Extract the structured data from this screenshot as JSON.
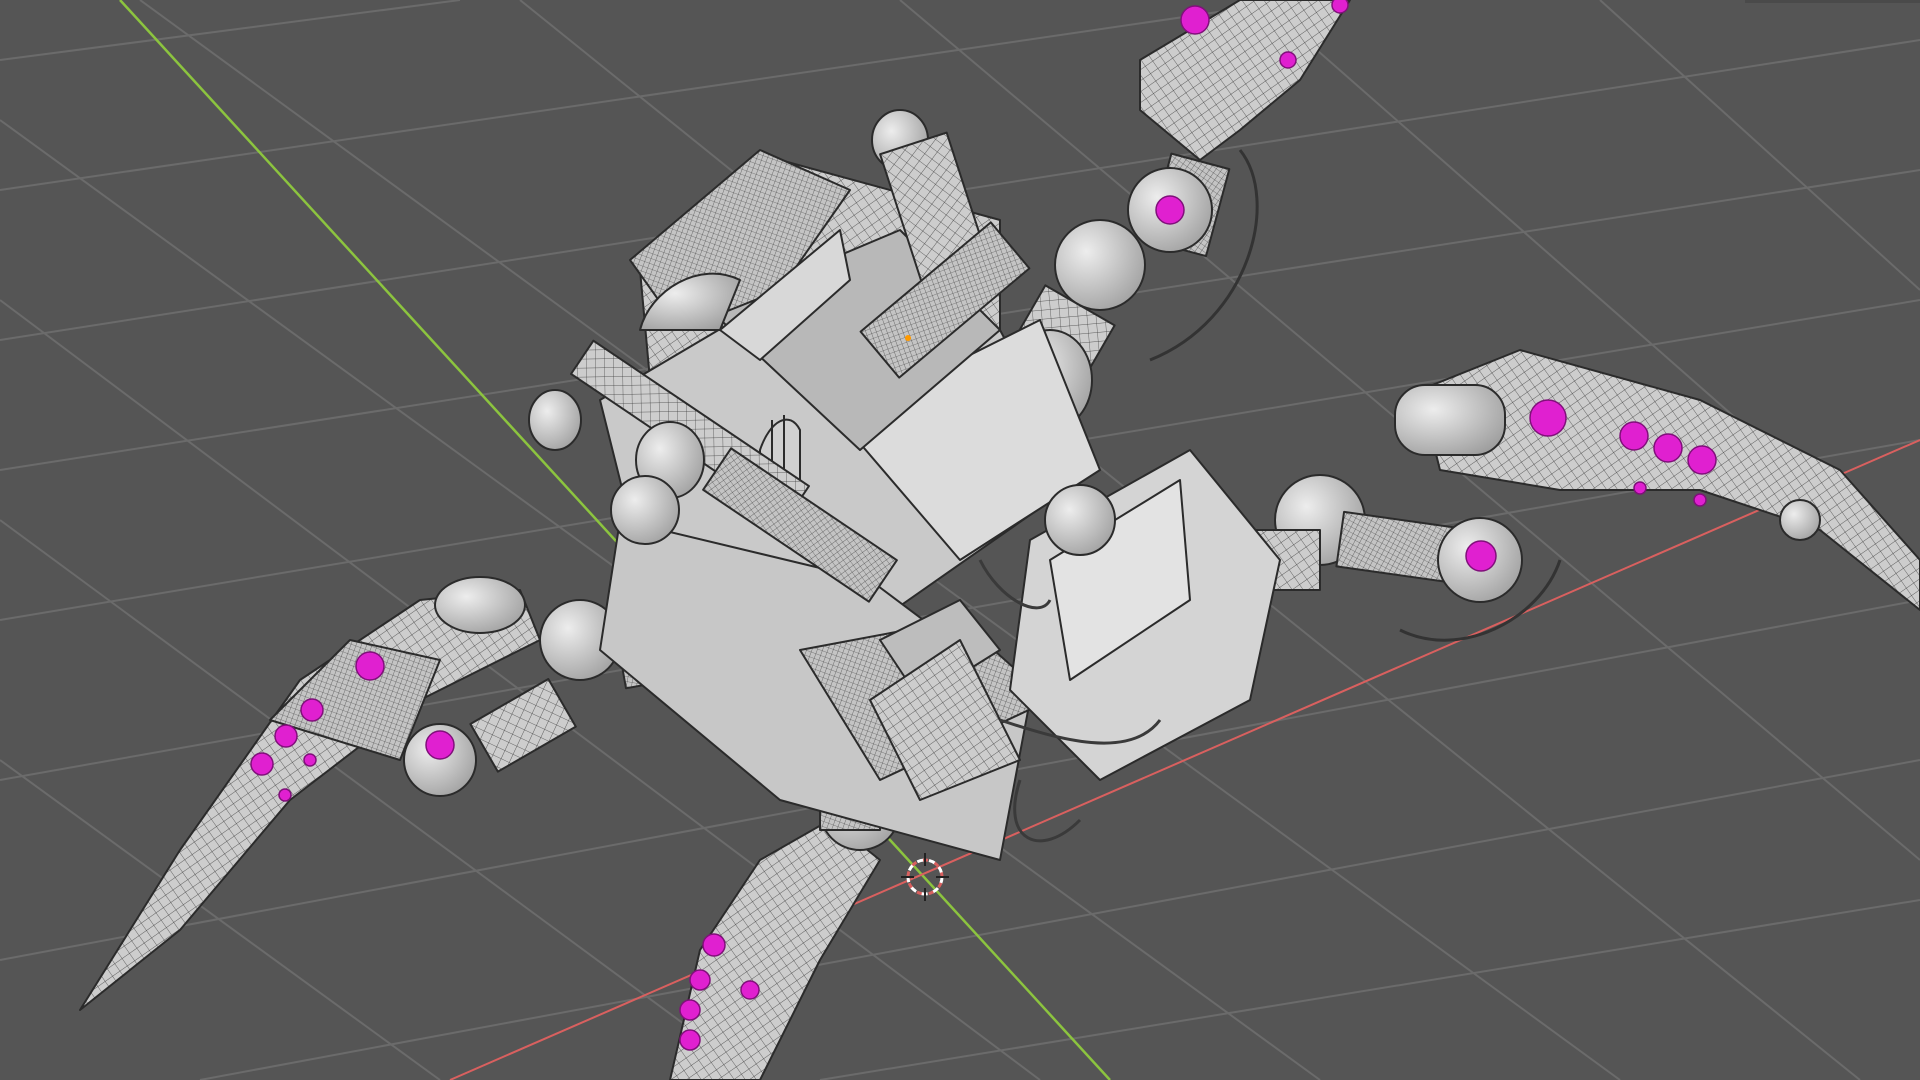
{
  "viewport": {
    "name": "3D Viewport",
    "mode": "wireframe-overlay",
    "background_color": "#555555",
    "grid_color": "#6a6a6a",
    "x_axis_color": "#d9605f",
    "y_axis_color": "#8cc43f",
    "selected_vertex_color": "#e020d0",
    "mesh_color": "#c9c9c9",
    "wire_color": "#2e2e2e"
  },
  "scene_object": {
    "description_icon": "robot-spider-mesh",
    "legs": 4
  },
  "cursor": {
    "icon": "3d-cursor-icon"
  }
}
